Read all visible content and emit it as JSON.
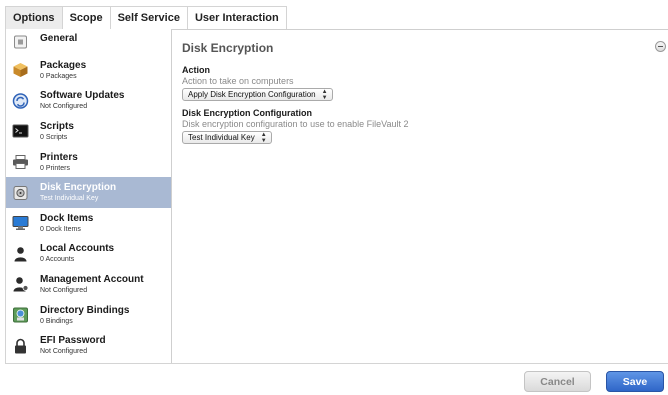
{
  "tabs": [
    {
      "label": "Options",
      "active": true
    },
    {
      "label": "Scope",
      "active": false
    },
    {
      "label": "Self Service",
      "active": false
    },
    {
      "label": "User Interaction",
      "active": false
    }
  ],
  "sidebar": {
    "items": [
      {
        "name": "General",
        "sub": "",
        "icon": "general-icon"
      },
      {
        "name": "Packages",
        "sub": "0 Packages",
        "icon": "package-icon"
      },
      {
        "name": "Software Updates",
        "sub": "Not Configured",
        "icon": "software-update-icon"
      },
      {
        "name": "Scripts",
        "sub": "0 Scripts",
        "icon": "terminal-icon"
      },
      {
        "name": "Printers",
        "sub": "0 Printers",
        "icon": "printer-icon"
      },
      {
        "name": "Disk Encryption",
        "sub": "Test Individual Key",
        "icon": "disk-lock-icon",
        "selected": true
      },
      {
        "name": "Dock Items",
        "sub": "0 Dock Items",
        "icon": "monitor-icon"
      },
      {
        "name": "Local Accounts",
        "sub": "0 Accounts",
        "icon": "user-icon"
      },
      {
        "name": "Management Account",
        "sub": "Not Configured",
        "icon": "admin-user-icon"
      },
      {
        "name": "Directory Bindings",
        "sub": "0 Bindings",
        "icon": "directory-icon"
      },
      {
        "name": "EFI Password",
        "sub": "Not Configured",
        "icon": "lock-icon"
      }
    ]
  },
  "main": {
    "title": "Disk Encryption",
    "action_label": "Action",
    "action_help": "Action to take on computers",
    "action_value": "Apply Disk Encryption Configuration",
    "config_label": "Disk Encryption Configuration",
    "config_help": "Disk encryption configuration to use to enable FileVault 2",
    "config_value": "Test Individual Key"
  },
  "footer": {
    "cancel_label": "Cancel",
    "save_label": "Save"
  },
  "colors": {
    "selected_row": "#a9b9d3",
    "save_button": "#3a72d4"
  }
}
